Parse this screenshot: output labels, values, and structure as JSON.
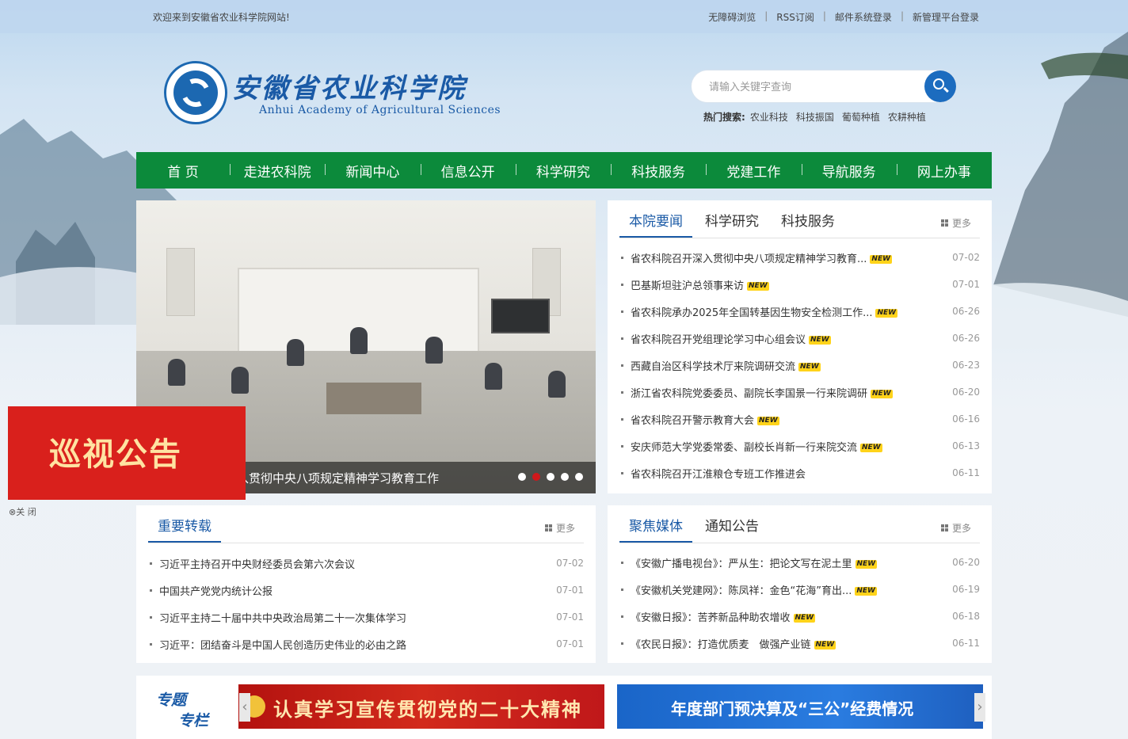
{
  "topbar": {
    "welcome": "欢迎来到安徽省农业科学院网站!",
    "links": [
      "无障碍浏览",
      "RSS订阅",
      "邮件系统登录",
      "新管理平台登录"
    ]
  },
  "header": {
    "title_cn": "安徽省农业科学院",
    "title_en": "Anhui Academy of Agricultural Sciences",
    "search_placeholder": "请输入关键字查询",
    "hot_label": "热门搜索:",
    "hot_keywords": [
      "农业科技",
      "科技振国",
      "葡萄种植",
      "农耕种植"
    ]
  },
  "nav": [
    "首 页",
    "走进农科院",
    "新闻中心",
    "信息公开",
    "科学研究",
    "科技服务",
    "党建工作",
    "导航服务",
    "网上办事"
  ],
  "slider": {
    "caption": "入贯彻中央八项规定精神学习教育工作",
    "dot_count": 5,
    "active_dot": 2
  },
  "news_panel": {
    "tabs": [
      "本院要闻",
      "科学研究",
      "科技服务"
    ],
    "active_tab": 0,
    "more": "更多",
    "new_badge": "NEW",
    "items": [
      {
        "title": "省农科院召开深入贯彻中央八项规定精神学习教育...",
        "date": "07-02",
        "new": true
      },
      {
        "title": "巴基斯坦驻沪总领事来访",
        "date": "07-01",
        "new": true
      },
      {
        "title": "省农科院承办2025年全国转基因生物安全检测工作...",
        "date": "06-26",
        "new": true
      },
      {
        "title": "省农科院召开党组理论学习中心组会议",
        "date": "06-26",
        "new": true
      },
      {
        "title": "西藏自治区科学技术厅来院调研交流",
        "date": "06-23",
        "new": true
      },
      {
        "title": "浙江省农科院党委委员、副院长李国景一行来院调研",
        "date": "06-20",
        "new": true
      },
      {
        "title": "省农科院召开警示教育大会",
        "date": "06-16",
        "new": true
      },
      {
        "title": "安庆师范大学党委常委、副校长肖新一行来院交流",
        "date": "06-13",
        "new": true
      },
      {
        "title": "省农科院召开江淮粮仓专班工作推进会",
        "date": "06-11",
        "new": false
      }
    ]
  },
  "repost_panel": {
    "tabs": [
      "重要转载"
    ],
    "active_tab": 0,
    "more": "更多",
    "items": [
      {
        "title": "习近平主持召开中央财经委员会第六次会议",
        "date": "07-02"
      },
      {
        "title": "中国共产党党内统计公报",
        "date": "07-01"
      },
      {
        "title": "习近平主持二十届中共中央政治局第二十一次集体学习",
        "date": "07-01"
      },
      {
        "title": "习近平：团结奋斗是中国人民创造历史伟业的必由之路",
        "date": "07-01"
      }
    ]
  },
  "media_panel": {
    "tabs": [
      "聚焦媒体",
      "通知公告"
    ],
    "active_tab": 0,
    "more": "更多",
    "new_badge": "NEW",
    "items": [
      {
        "title": "《安徽广播电视台》：严从生：把论文写在泥土里",
        "date": "06-20",
        "new": true
      },
      {
        "title": "《安徽机关党建网》：陈凤祥：金色“花海”育出...",
        "date": "06-19",
        "new": true
      },
      {
        "title": "《安徽日报》：苦荞新品种助农增收",
        "date": "06-18",
        "new": true
      },
      {
        "title": "《农民日报》：打造优质麦　做强产业链",
        "date": "06-11",
        "new": true
      }
    ]
  },
  "notice": {
    "text": "巡视公告",
    "close": "⊗关 闭"
  },
  "special": {
    "label_line1": "专题",
    "label_line2": "专栏",
    "banner1": "认真学习宣传贯彻党的二十大精神",
    "banner2": "年度部门预决算及“三公”经费情况"
  },
  "colors": {
    "nav_green": "#0c8a3b",
    "brand_blue": "#1a5aa6",
    "notice_red": "#d9201c",
    "new_badge": "#ffd31a"
  }
}
